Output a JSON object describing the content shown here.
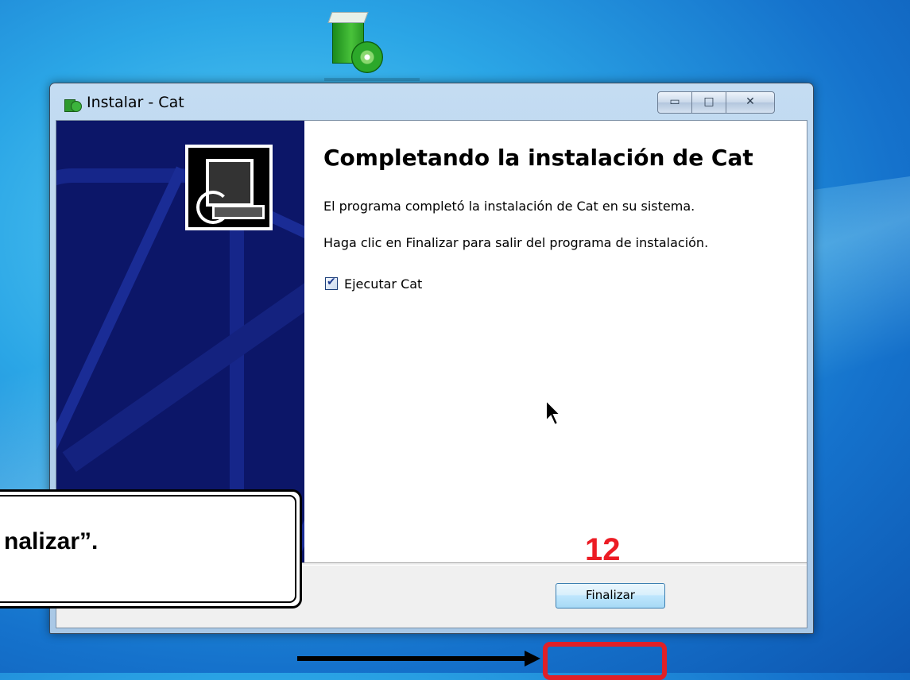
{
  "window": {
    "title": "Instalar - Cat",
    "controls": {
      "minimize": "▭",
      "maximize": "□",
      "close": "✕"
    }
  },
  "content": {
    "heading": "Completando la instalación de Cat",
    "paragraph1": "El programa completó la instalación de Cat en su sistema.",
    "paragraph2": "Haga clic en Finalizar para salir del programa de instalación.",
    "checkbox": {
      "label": "Ejecutar Cat",
      "checked": true,
      "mark": "✔"
    }
  },
  "footer": {
    "finish_button": "Finalizar"
  },
  "annotation": {
    "callout_text": "nalizar”.",
    "step_number": "12",
    "highlight_color": "#e02027"
  },
  "icons": {
    "desktop": "installer-package-icon",
    "title": "installer-app-icon",
    "cursor": "mouse-pointer-icon"
  }
}
